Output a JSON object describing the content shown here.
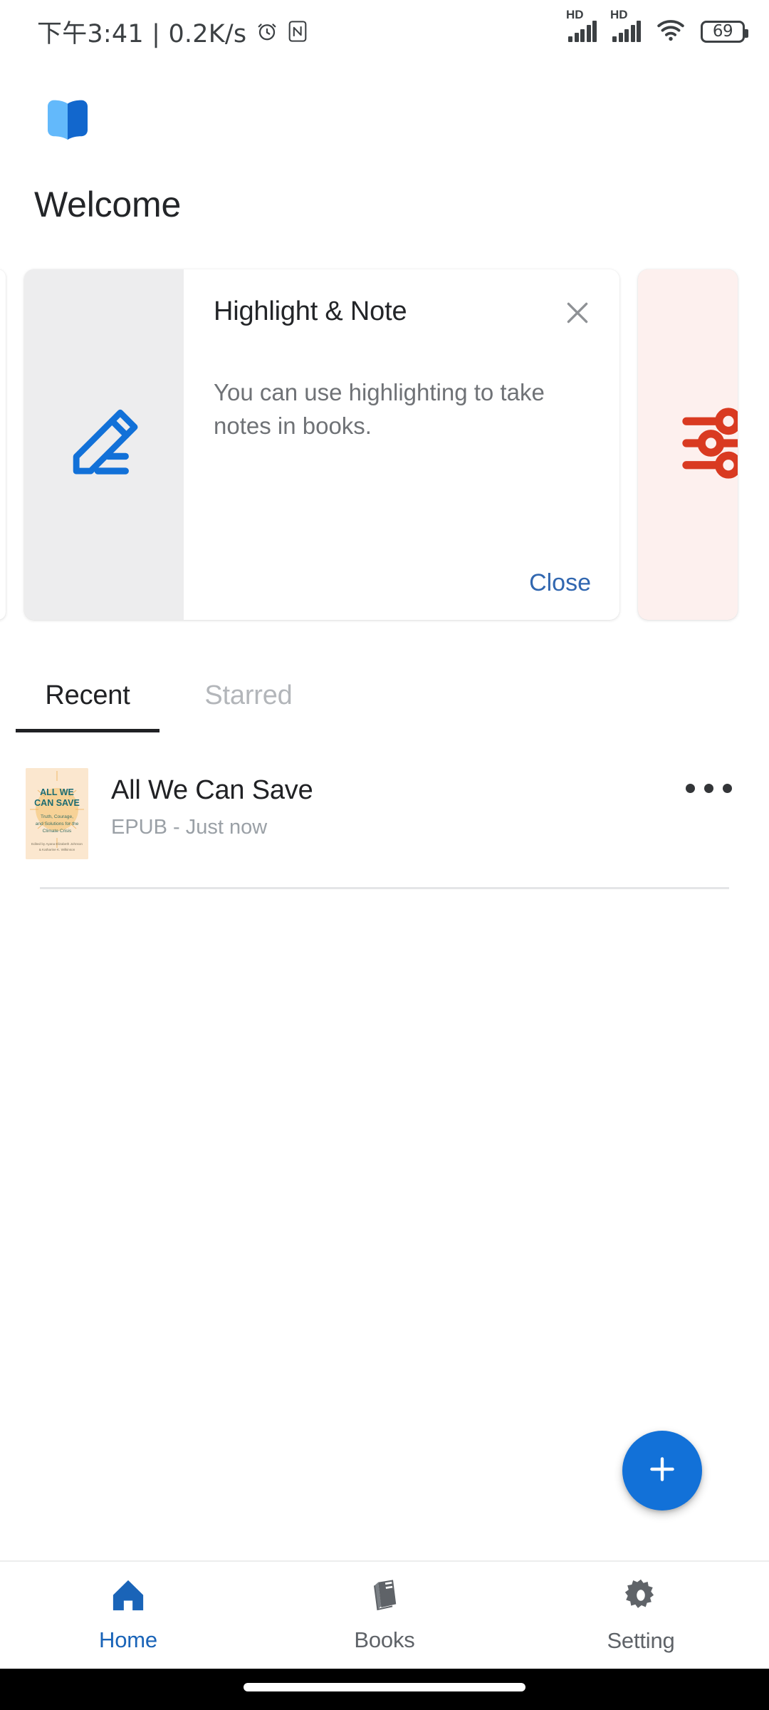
{
  "statusbar": {
    "time": "下午3:41 | 0.2K/s",
    "alarm_icon": "alarm-clock-icon",
    "nfc_icon": "nfc-icon",
    "signal_1_label": "HD",
    "signal_2_label": "HD",
    "wifi_icon": "wifi-icon",
    "battery_level": "69"
  },
  "header": {
    "logo_icon": "open-book-logo-icon",
    "title": "Welcome"
  },
  "carousel": {
    "card": {
      "icon": "pencil-edit-icon",
      "title": "Highlight & Note",
      "close_icon": "close-x-icon",
      "text": "You can use highlighting to take notes in books.",
      "action_label": "Close"
    },
    "peek_right": {
      "icon": "tune-sliders-icon"
    }
  },
  "tabs": [
    {
      "label": "Recent",
      "active": true
    },
    {
      "label": "Starred",
      "active": false
    }
  ],
  "books": [
    {
      "cover_title_line1": "ALL WE",
      "cover_title_line2": "CAN SAVE",
      "cover_sub_line1": "Truth, Courage,",
      "cover_sub_line2": "and Solutions for the",
      "cover_sub_line3": "Climate Crisis",
      "title": "All We Can Save",
      "subtitle": "EPUB - Just now",
      "more_icon": "more-horizontal-icon"
    }
  ],
  "fab": {
    "icon": "plus-icon"
  },
  "bottomnav": [
    {
      "label": "Home",
      "icon": "home-icon",
      "active": true
    },
    {
      "label": "Books",
      "icon": "books-icon",
      "active": false
    },
    {
      "label": "Setting",
      "icon": "gear-icon",
      "active": false
    }
  ],
  "colors": {
    "accent_blue": "#1271d8",
    "link_blue": "#3167b0",
    "nav_active": "#1a64b8",
    "peek_red": "#d93a21",
    "peek_bg": "#fdf0ee",
    "icon_pane_bg": "#ededee"
  }
}
